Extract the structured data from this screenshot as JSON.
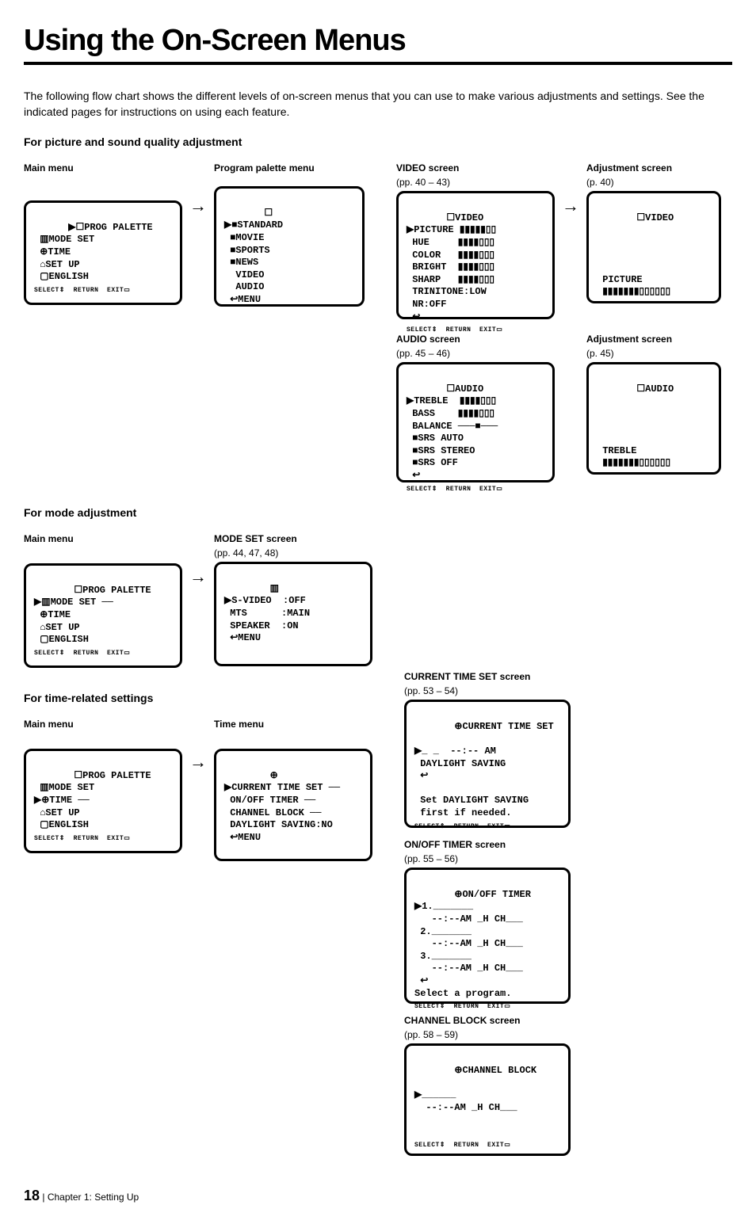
{
  "title": "Using the On-Screen Menus",
  "intro": "The following flow chart shows the different levels of on-screen menus that you can use to make various adjustments and settings. See the indicated pages for instructions on using each feature.",
  "sections": {
    "picture_sound": "For picture and sound quality adjustment",
    "mode": "For mode adjustment",
    "time": "For time-related settings"
  },
  "labels": {
    "main_menu": "Main menu",
    "program_palette": "Program palette menu",
    "video_screen": "VIDEO screen",
    "video_pages": "(pp. 40 – 43)",
    "adjust_screen": "Adjustment screen",
    "adjust_p40": "(p. 40)",
    "audio_screen": "AUDIO screen",
    "audio_pages": "(pp. 45 – 46)",
    "adjust_p45": "(p. 45)",
    "mode_set_screen": "MODE SET screen",
    "mode_set_pages": "(pp. 44, 47, 48)",
    "time_menu": "Time menu",
    "current_time": "CURRENT TIME SET screen",
    "current_time_pages": "(pp. 53 – 54)",
    "onoff_timer": "ON/OFF TIMER screen",
    "onoff_timer_pages": "(pp. 55 – 56)",
    "channel_block": "CHANNEL BLOCK screen",
    "channel_block_pages": "(pp. 58 – 59)"
  },
  "screens": {
    "main1": "▶☐PROG PALETTE\n ▥MODE SET\n ⊕TIME\n ⌂SET UP\n ▢ENGLISH",
    "foot": "SELECT⇕  RETURN  EXIT▭",
    "program_palette": " ☐\n▶■STANDARD\n ■MOVIE\n ■SPORTS\n ■NEWS\n  VIDEO\n  AUDIO\n ↩MENU",
    "video": " ☐VIDEO\n▶PICTURE ▮▮▮▮▮▯▯\n HUE     ▮▮▮▮▯▯▯\n COLOR   ▮▮▮▮▯▯▯\n BRIGHT  ▮▮▮▮▯▯▯\n SHARP   ▮▮▮▮▯▯▯\n TRINITONE:LOW\n NR:OFF\n ↩",
    "adjust_video": " ☐VIDEO\n\n\n\n\n PICTURE\n ▮▮▮▮▮▮▮▯▯▯▯▯▯",
    "audio": " ☐AUDIO\n▶TREBLE  ▮▮▮▮▯▯▯\n BASS    ▮▮▮▮▯▯▯\n BALANCE ───■───\n ■SRS AUTO\n ■SRS STEREO\n ■SRS OFF\n ↩",
    "adjust_audio": " ☐AUDIO\n\n\n\n\n TREBLE\n ▮▮▮▮▮▮▮▯▯▯▯▯▯",
    "main2": " ☐PROG PALETTE\n▶▥MODE SET ──\n ⊕TIME\n ⌂SET UP\n ▢ENGLISH",
    "mode_set": "  ▥\n▶S-VIDEO  :OFF\n MTS      :MAIN\n SPEAKER  :ON\n ↩MENU",
    "main3": " ☐PROG PALETTE\n ▥MODE SET\n▶⊕TIME ──\n ⌂SET UP\n ▢ENGLISH",
    "time_menu": "  ⊕\n▶CURRENT TIME SET ──\n ON/OFF TIMER ──\n CHANNEL BLOCK ──\n DAYLIGHT SAVING:NO\n ↩MENU",
    "current_time": " ⊕CURRENT TIME SET\n\n▶_ _  --:-- AM\n DAYLIGHT SAVING\n ↩\n\n Set DAYLIGHT SAVING\n first if needed.",
    "onoff": " ⊕ON/OFF TIMER\n▶1._______\n   --:--AM _H CH___\n 2._______\n   --:--AM _H CH___\n 3._______\n   --:--AM _H CH___\n ↩\nSelect a program.",
    "chblock": " ⊕CHANNEL BLOCK\n\n▶______\n  --:--AM _H CH___\n\n"
  },
  "footer": {
    "page": "18",
    "chapter": "Chapter 1: Setting Up"
  }
}
